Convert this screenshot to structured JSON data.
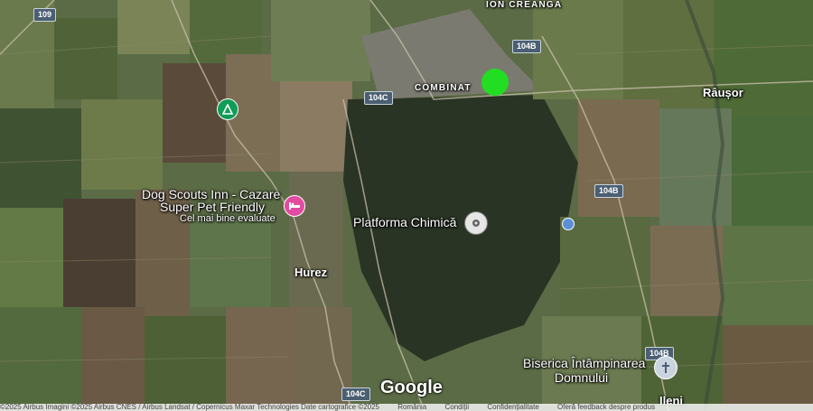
{
  "map": {
    "towns": {
      "ion_creanga": "ION CREANGA",
      "combinat": "COMBINAT",
      "rausor": "Râușor",
      "hurez": "Hurez",
      "ileni": "Ileni"
    },
    "roads": {
      "r109": "109",
      "r104c_top": "104C",
      "r104c_bottom": "104C",
      "r104b_top": "104B",
      "r104b_mid": "104B",
      "r104b_bottom": "104B"
    },
    "pois": {
      "dog_scouts_line1": "Dog Scouts Inn - Cazare",
      "dog_scouts_line2": "Super Pet Friendly",
      "dog_scouts_sub": "Cel mai bine evaluate",
      "platforma": "Platforma Chimică",
      "biserica_line1": "Biserica Întâmpinarea",
      "biserica_line2": "Domnului"
    },
    "markers": {
      "selected_color": "#22dd22"
    },
    "google_logo": "Google"
  },
  "footer": {
    "attribution": "©2025 Airbus Imagini ©2025 Airbus CNES / Airbus Landsat / Copernicus Maxar Technologies Date cartografice ©2025",
    "country": "România",
    "terms": "Condiții",
    "privacy": "Confidențialitate",
    "feedback": "Oferă feedback despre produs"
  }
}
